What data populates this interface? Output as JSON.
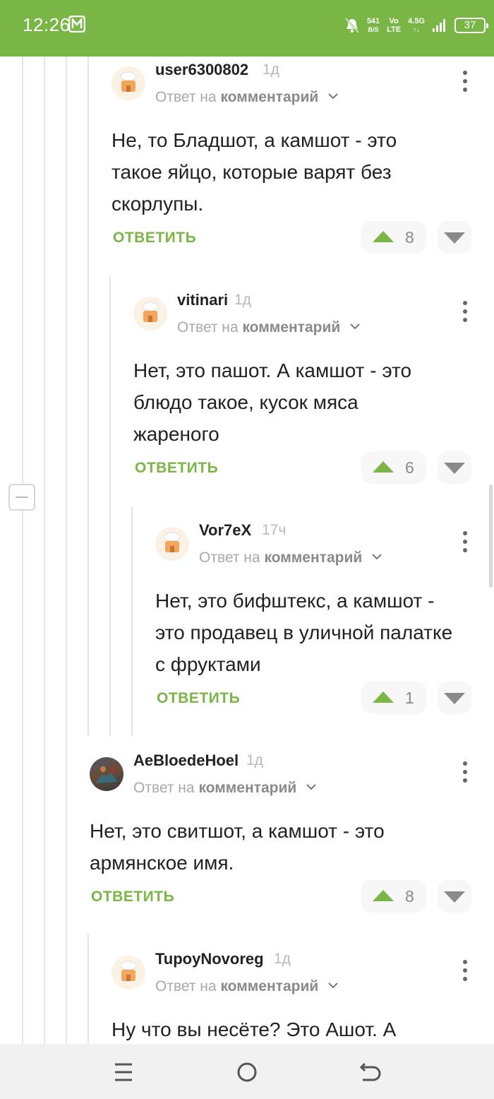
{
  "status_bar": {
    "time": "12:26",
    "net_speed_value": "541",
    "net_speed_unit": "B/S",
    "volte_top": "Vo",
    "volte_bottom": "LTE",
    "network_type": "4.5G",
    "battery": "37"
  },
  "comments": [
    {
      "author": "user6300802",
      "time": "1д",
      "reply_prefix": "Ответ на",
      "reply_target": "комментарий",
      "text": "Не, то Бладшот, а камшот - это такое яйцо, которые варят без скорлупы.",
      "reply_label": "ОТВЕТИТЬ",
      "votes": "8"
    },
    {
      "author": "vitinari",
      "time": "1д",
      "reply_prefix": "Ответ на",
      "reply_target": "комментарий",
      "text": "Нет, это пашот. А камшот - это блюдо такое, кусок мяса жареного",
      "reply_label": "ОТВЕТИТЬ",
      "votes": "6"
    },
    {
      "author": "Vor7eX",
      "time": "17ч",
      "reply_prefix": "Ответ на",
      "reply_target": "комментарий",
      "text": "Нет, это бифштекс, а камшот - это продавец в уличной палатке с фруктами",
      "reply_label": "ОТВЕТИТЬ",
      "votes": "1"
    },
    {
      "author": "AeBloedeHoel",
      "time": "1д",
      "reply_prefix": "Ответ на",
      "reply_target": "комментарий",
      "text": "Нет, это свитшот, а камшот - это армянское имя.",
      "reply_label": "ОТВЕТИТЬ",
      "votes": "8"
    },
    {
      "author": "TupoyNovoreg",
      "time": "1д",
      "reply_prefix": "Ответ на",
      "reply_target": "комментарий",
      "text": "Ну что вы несёте? Это Ашот. А"
    }
  ],
  "icons": {
    "avatar_default": "chef-hat-house-icon",
    "menu": "kebab-menu-icon",
    "upvote": "upvote-triangle-icon",
    "downvote": "downvote-triangle-icon",
    "collapse": "collapse-minus-icon",
    "nav": [
      "recent-apps-icon",
      "home-icon",
      "back-icon"
    ]
  },
  "colors": {
    "brand_green": "#79b646",
    "text": "#222222",
    "muted": "#a9a9a9"
  }
}
